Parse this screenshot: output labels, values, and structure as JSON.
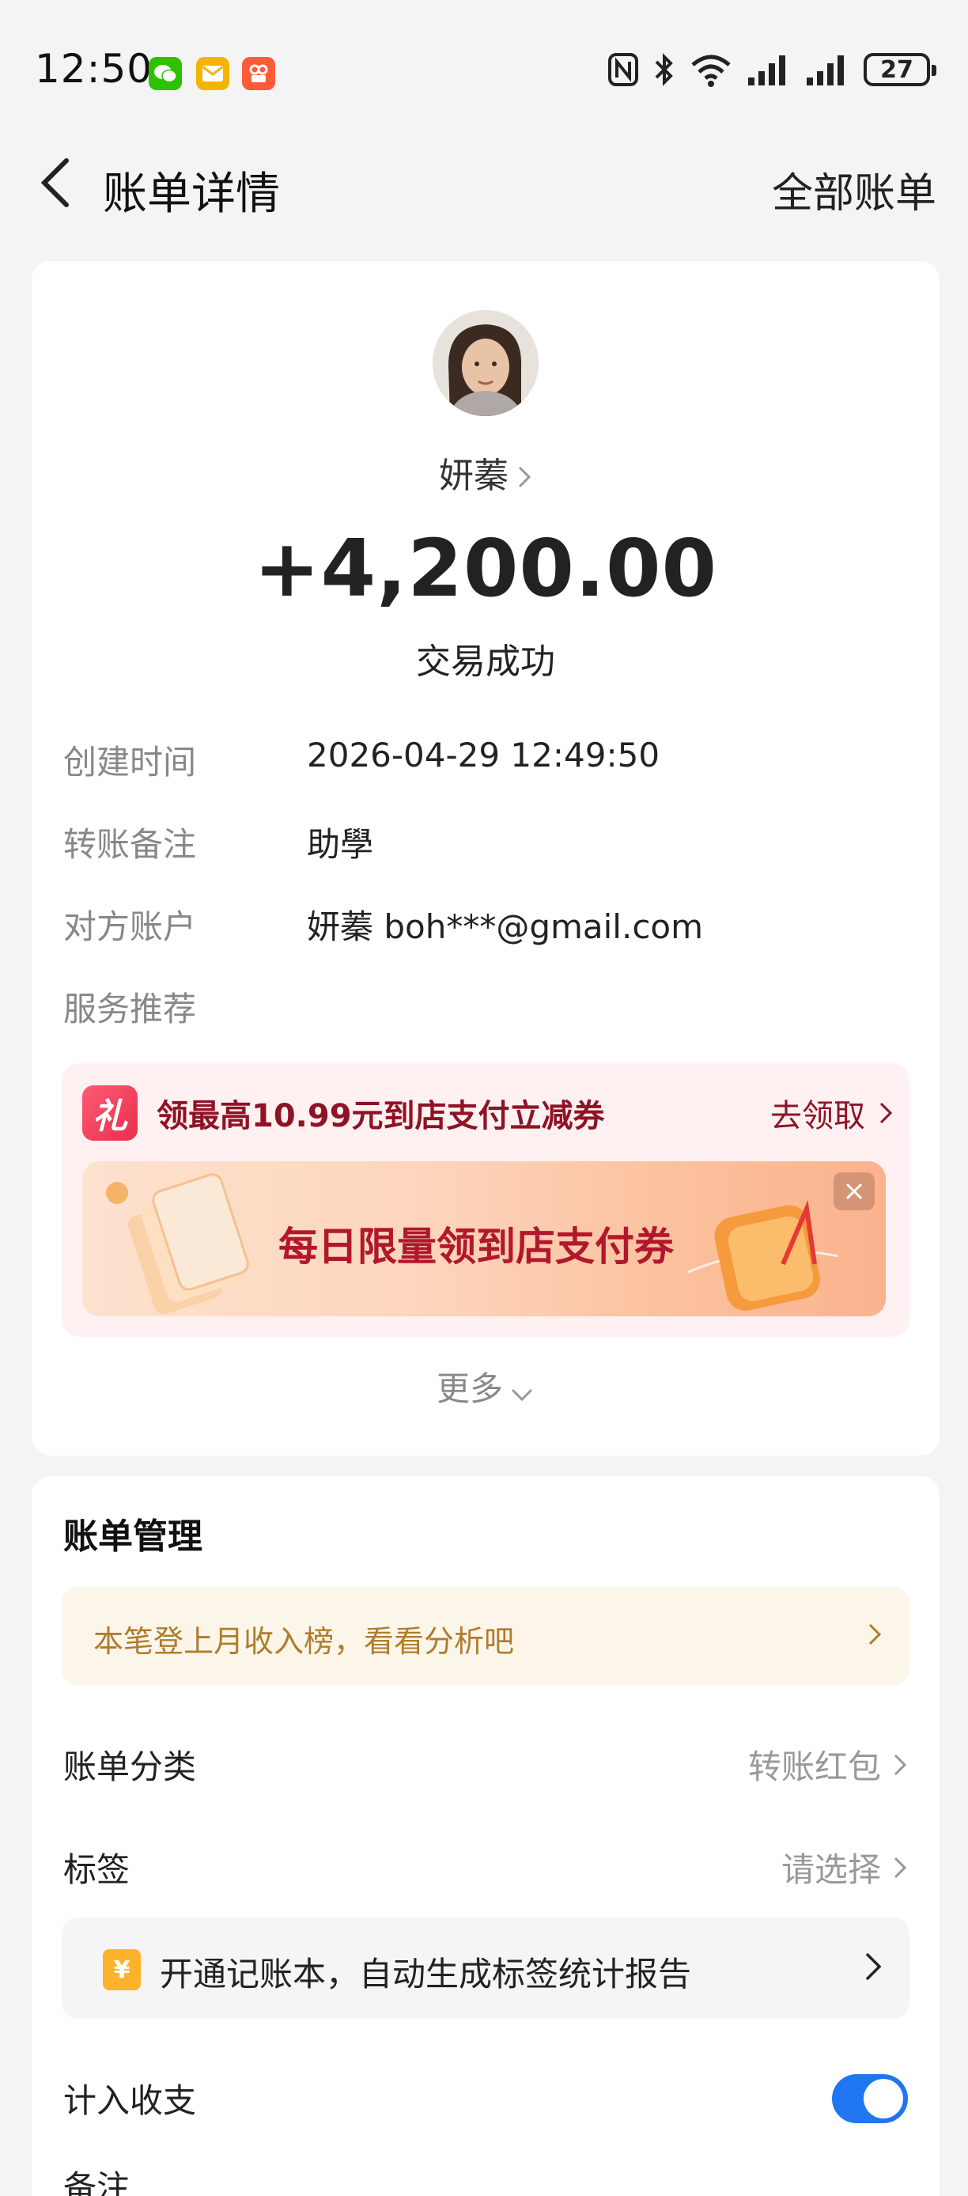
{
  "status_bar": {
    "time": "12:50",
    "battery": "27",
    "app_icons": [
      "wechat-icon",
      "mail-icon",
      "video-app-icon"
    ]
  },
  "header": {
    "title": "账单详情",
    "right_link": "全部账单"
  },
  "transaction": {
    "counterparty_name": "妍蓁",
    "amount": "+4,200.00",
    "status": "交易成功"
  },
  "details": [
    {
      "label": "创建时间",
      "value": "2026-04-29 12:49:50"
    },
    {
      "label": "转账备注",
      "value": "助學"
    },
    {
      "label": "对方账户",
      "value": "妍蓁 boh***@gmail.com"
    },
    {
      "label": "服务推荐",
      "value": ""
    }
  ],
  "promo": {
    "gift_glyph": "礼",
    "text": "领最高10.99元到店支付立减券",
    "action": "去领取",
    "banner_text": "每日限量领到店支付券"
  },
  "more_label": "更多",
  "management": {
    "title": "账单管理",
    "insight": "本笔登上月收入榜，看看分析吧",
    "rows": [
      {
        "label": "账单分类",
        "value": "转账红包"
      },
      {
        "label": "标签",
        "value": "请选择"
      }
    ],
    "notebook_text": "开通记账本，自动生成标签统计报告",
    "notebook_icon_glyph": "¥",
    "include_label": "计入收支",
    "include_enabled": true,
    "remark_label": "备注"
  },
  "colors": {
    "accent_blue": "#1f76f0",
    "promo_red": "#8f1225",
    "insight_gold": "#b07c2c"
  }
}
